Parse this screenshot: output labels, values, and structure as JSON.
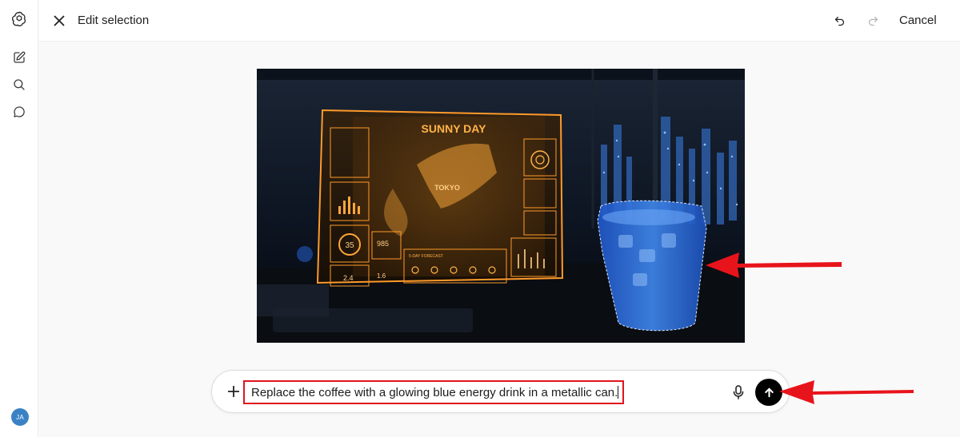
{
  "sidebar": {
    "logo_icon": "openai-logo-icon",
    "items": [
      {
        "name": "new-chat",
        "icon": "edit-icon"
      },
      {
        "name": "search",
        "icon": "search-icon"
      },
      {
        "name": "chats",
        "icon": "chat-bubble-icon"
      }
    ],
    "avatar_initials": "JA",
    "avatar_color": "#3b82c4"
  },
  "header": {
    "title": "Edit selection",
    "close_icon": "close-icon",
    "undo_icon": "undo-icon",
    "redo_icon": "redo-icon",
    "cancel_label": "Cancel"
  },
  "image": {
    "hologram_title": "SUNNY DAY",
    "map_label": "TOKYO",
    "gauge_value": "35",
    "pressure_value": "985",
    "storm_value": "2.4",
    "rain_value": "1.6",
    "forecast_label": "5-DAY FORECAST",
    "selection": "glass-selection"
  },
  "composer": {
    "prompt_text": "Replace the coffee with a glowing blue energy drink in a metallic can.",
    "plus_icon": "plus-icon",
    "mic_icon": "microphone-icon",
    "send_icon": "arrow-up-icon"
  },
  "colors": {
    "highlight_red": "#e0141d",
    "hologram_orange": "#f5a623",
    "selection_blue": "#2f6fd6"
  }
}
